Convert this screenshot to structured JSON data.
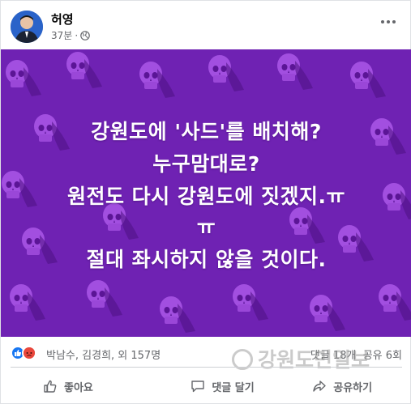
{
  "post": {
    "author": "허영",
    "time": "37분",
    "privacy_icon": "globe-icon",
    "image_text": {
      "line1": "강원도에 '사드'를 배치해?",
      "line2": "누구맘대로?",
      "line3": "원전도 다시 강원도에 짓겠지.ㅠ",
      "line4": "ㅠ",
      "line5": "절대 좌시하지 않을 것이다."
    },
    "image_bg_color": "#6f22b3",
    "reactions": {
      "names": "박남수, 김경희, 외 157명",
      "comments": "댓글 18개",
      "shares": "공유 6회"
    },
    "actions": {
      "like": "좋아요",
      "comment": "댓글 달기",
      "share": "공유하기"
    },
    "watermark": "강원도민일보"
  }
}
